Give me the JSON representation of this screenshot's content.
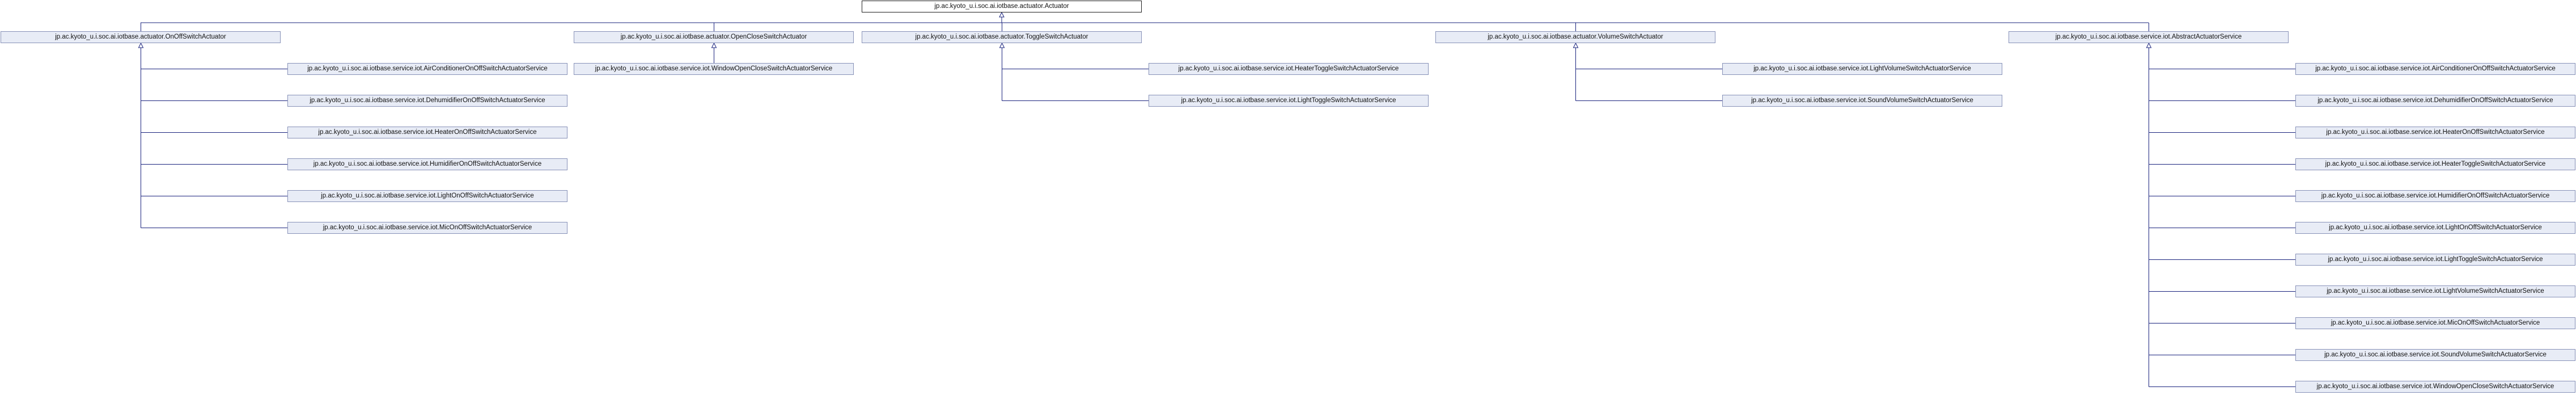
{
  "nodes": {
    "actuator": "jp.ac.kyoto_u.i.soc.ai.iotbase.actuator.Actuator",
    "onoff": "jp.ac.kyoto_u.i.soc.ai.iotbase.actuator.OnOffSwitchActuator",
    "openclose": "jp.ac.kyoto_u.i.soc.ai.iotbase.actuator.OpenCloseSwitchActuator",
    "toggle": "jp.ac.kyoto_u.i.soc.ai.iotbase.actuator.ToggleSwitchActuator",
    "volume": "jp.ac.kyoto_u.i.soc.ai.iotbase.actuator.VolumeSwitchActuator",
    "abstract": "jp.ac.kyoto_u.i.soc.ai.iotbase.service.iot.AbstractActuatorService",
    "onoff_aircon": "jp.ac.kyoto_u.i.soc.ai.iotbase.service.iot.AirConditionerOnOffSwitchActuatorService",
    "onoff_dehum": "jp.ac.kyoto_u.i.soc.ai.iotbase.service.iot.DehumidifierOnOffSwitchActuatorService",
    "onoff_heater": "jp.ac.kyoto_u.i.soc.ai.iotbase.service.iot.HeaterOnOffSwitchActuatorService",
    "onoff_hum": "jp.ac.kyoto_u.i.soc.ai.iotbase.service.iot.HumidifierOnOffSwitchActuatorService",
    "onoff_light": "jp.ac.kyoto_u.i.soc.ai.iotbase.service.iot.LightOnOffSwitchActuatorService",
    "onoff_mic": "jp.ac.kyoto_u.i.soc.ai.iotbase.service.iot.MicOnOffSwitchActuatorService",
    "oc_window": "jp.ac.kyoto_u.i.soc.ai.iotbase.service.iot.WindowOpenCloseSwitchActuatorService",
    "tg_heater": "jp.ac.kyoto_u.i.soc.ai.iotbase.service.iot.HeaterToggleSwitchActuatorService",
    "tg_light": "jp.ac.kyoto_u.i.soc.ai.iotbase.service.iot.LightToggleSwitchActuatorService",
    "vol_light": "jp.ac.kyoto_u.i.soc.ai.iotbase.service.iot.LightVolumeSwitchActuatorService",
    "vol_sound": "jp.ac.kyoto_u.i.soc.ai.iotbase.service.iot.SoundVolumeSwitchActuatorService",
    "ab_aircon": "jp.ac.kyoto_u.i.soc.ai.iotbase.service.iot.AirConditionerOnOffSwitchActuatorService",
    "ab_dehum": "jp.ac.kyoto_u.i.soc.ai.iotbase.service.iot.DehumidifierOnOffSwitchActuatorService",
    "ab_heater_onoff": "jp.ac.kyoto_u.i.soc.ai.iotbase.service.iot.HeaterOnOffSwitchActuatorService",
    "ab_heater_toggle": "jp.ac.kyoto_u.i.soc.ai.iotbase.service.iot.HeaterToggleSwitchActuatorService",
    "ab_hum": "jp.ac.kyoto_u.i.soc.ai.iotbase.service.iot.HumidifierOnOffSwitchActuatorService",
    "ab_light_onoff": "jp.ac.kyoto_u.i.soc.ai.iotbase.service.iot.LightOnOffSwitchActuatorService",
    "ab_light_toggle": "jp.ac.kyoto_u.i.soc.ai.iotbase.service.iot.LightToggleSwitchActuatorService",
    "ab_light_volume": "jp.ac.kyoto_u.i.soc.ai.iotbase.service.iot.LightVolumeSwitchActuatorService",
    "ab_mic": "jp.ac.kyoto_u.i.soc.ai.iotbase.service.iot.MicOnOffSwitchActuatorService",
    "ab_sound": "jp.ac.kyoto_u.i.soc.ai.iotbase.service.iot.SoundVolumeSwitchActuatorService",
    "ab_window": "jp.ac.kyoto_u.i.soc.ai.iotbase.service.iot.WindowOpenCloseSwitchActuatorService"
  },
  "colors": {
    "node_fill": "#e8ecf6",
    "node_border": "#8892b8",
    "root_border": "#222222",
    "edge": "#1a237e"
  }
}
